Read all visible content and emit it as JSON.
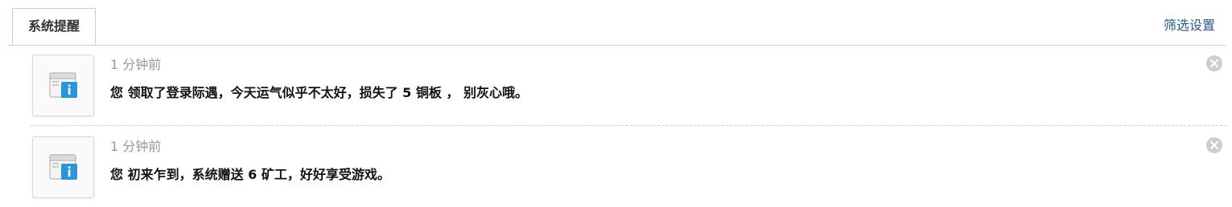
{
  "tabs": [
    {
      "label": "系统提醒",
      "active": true
    }
  ],
  "filter_link": "筛选设置",
  "notices": [
    {
      "time": "1 分钟前",
      "message": "您 领取了登录际遇，今天运气似乎不太好，损失了 5 铜板 ， 别灰心哦。",
      "icon": "info-window-icon"
    },
    {
      "time": "1 分钟前",
      "message": "您 初来乍到，系统赠送 6 矿工，好好享受游戏。",
      "icon": "info-window-icon"
    }
  ],
  "colors": {
    "link": "#2b5b8f",
    "border": "#cfcfcf",
    "muted_text": "#999999",
    "close_bg": "#cdcdcd"
  }
}
